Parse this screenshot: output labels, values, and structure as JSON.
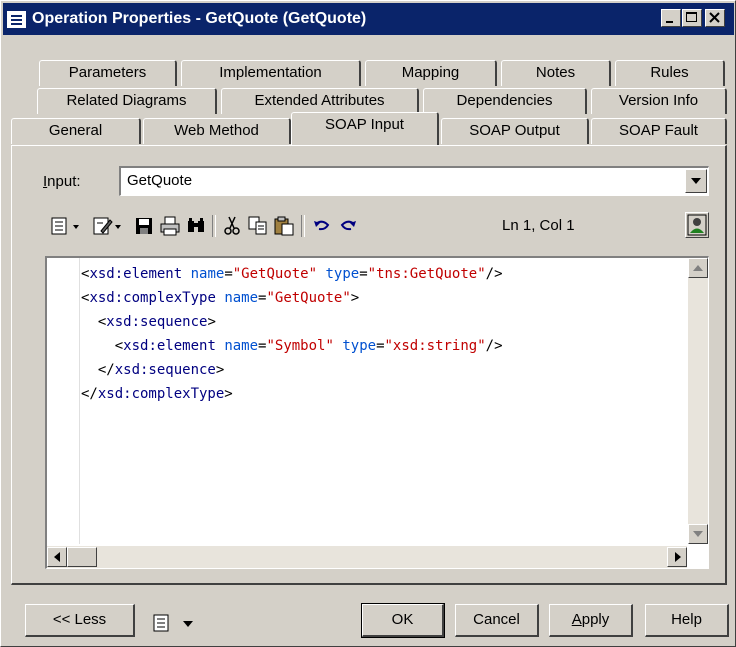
{
  "window": {
    "title": "Operation Properties - GetQuote (GetQuote)"
  },
  "tabs": {
    "row1": [
      "Parameters",
      "Implementation",
      "Mapping",
      "Notes",
      "Rules"
    ],
    "row2": [
      "Related Diagrams",
      "Extended Attributes",
      "Dependencies",
      "Version Info"
    ],
    "row3": [
      "General",
      "Web Method",
      "SOAP Input",
      "SOAP Output",
      "SOAP Fault"
    ],
    "active": "SOAP Input"
  },
  "input": {
    "label_hot": "I",
    "label_rest": "nput:",
    "value": "GetQuote"
  },
  "toolbar": {
    "icons": [
      "properties-icon",
      "edit-icon",
      "save-icon",
      "print-icon",
      "find-icon",
      "cut-icon",
      "copy-icon",
      "paste-icon",
      "undo-icon",
      "redo-icon"
    ],
    "position": "Ln 1, Col 1"
  },
  "editor": {
    "lines": [
      "<xsd:element name=\"GetQuote\" type=\"tns:GetQuote\"/>",
      "<xsd:complexType name=\"GetQuote\">",
      "  <xsd:sequence>",
      "    <xsd:element name=\"Symbol\" type=\"xsd:string\"/>",
      "  </xsd:sequence>",
      "</xsd:complexType>"
    ]
  },
  "buttons": {
    "less": "<< Less",
    "ok": "OK",
    "cancel": "Cancel",
    "apply_hot": "A",
    "apply_rest": "pply",
    "help": "Help"
  }
}
